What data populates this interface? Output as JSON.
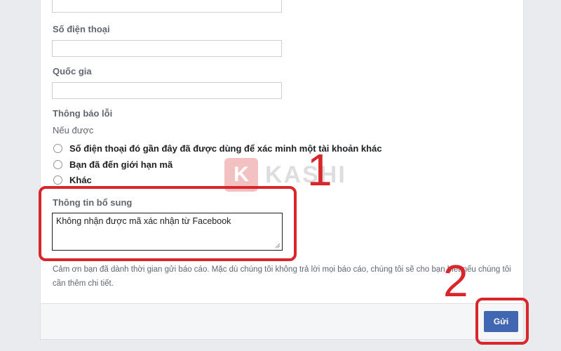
{
  "form": {
    "phone_label": "Số điện thoại",
    "phone_value": "",
    "country_label": "Quốc gia",
    "country_value": "",
    "error_label": "Thông báo lỗi",
    "if_possible_label": "Nếu được",
    "options": [
      {
        "label": "Số điện thoại đó gần đây đã được dùng để xác minh một tài khoản khác",
        "selected": false
      },
      {
        "label": "Bạn đã đến giới hạn mã",
        "selected": false
      },
      {
        "label": "Khác",
        "selected": false
      }
    ],
    "additional_info_label": "Thông tin bổ sung",
    "additional_info_value": "Không nhận được mã xác nhận từ Facebook",
    "thank_you_text": "Cảm ơn bạn đã dành thời gian gửi báo cáo. Mặc dù chúng tôi không trả lời mọi báo cáo, chúng tôi sẽ cho bạn biết nếu chúng tôi cần thêm chi tiết.",
    "submit_label": "Gửi"
  },
  "annotations": {
    "step_1": "1",
    "step_2": "2",
    "color": "#d9262b"
  },
  "watermark": {
    "logo_letter": "K",
    "text": "KASHI"
  }
}
